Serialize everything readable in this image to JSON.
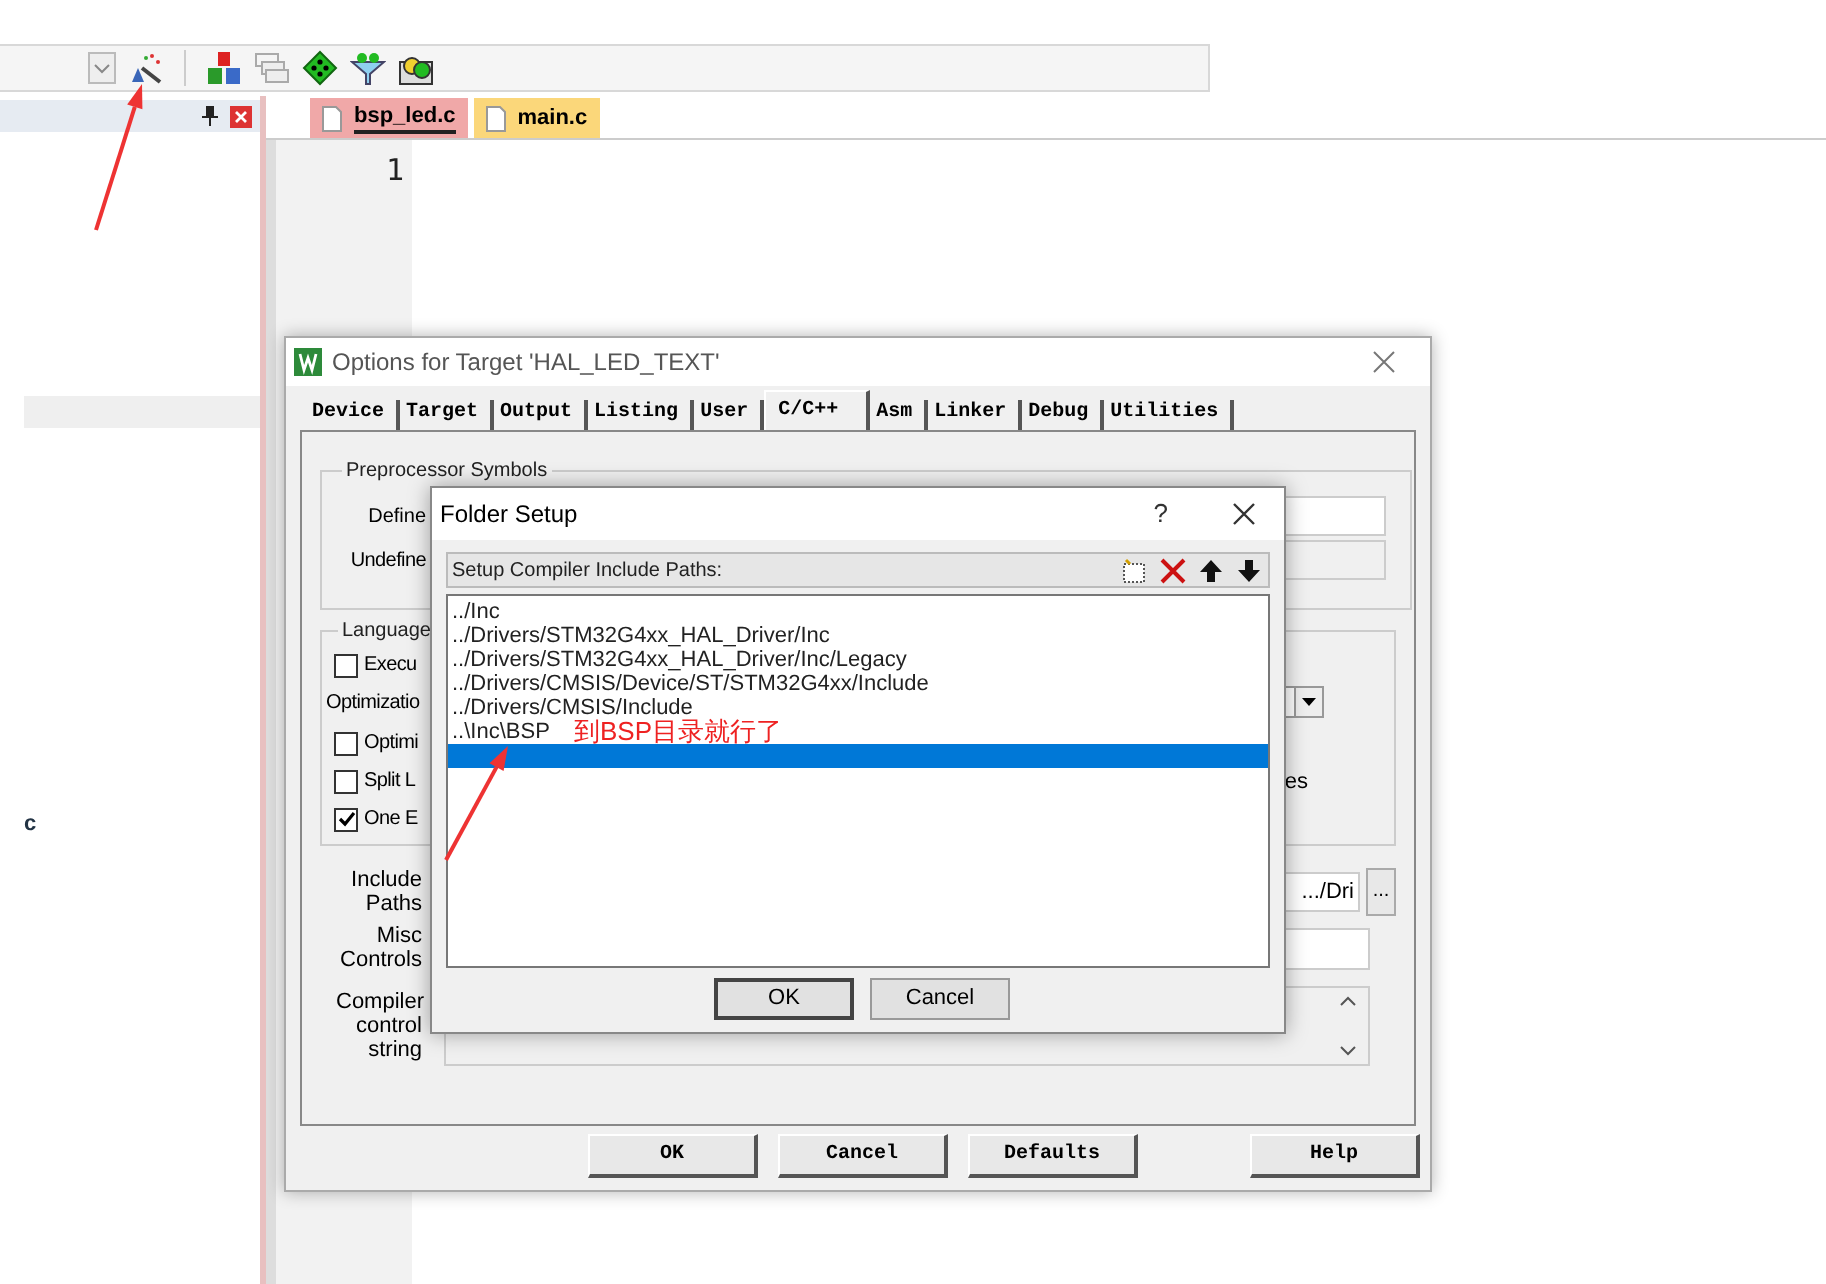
{
  "left_panel": {
    "items": [
      {
        "text": "c"
      }
    ]
  },
  "editor": {
    "tabs": [
      {
        "label": "bsp_led.c",
        "selected": true
      },
      {
        "label": "main.c",
        "selected": false
      }
    ],
    "line_numbers": [
      "1"
    ]
  },
  "options_dialog": {
    "title": "Options for Target 'HAL_LED_TEXT'",
    "tabs": [
      {
        "label": "Device",
        "selected": false
      },
      {
        "label": "Target",
        "selected": false
      },
      {
        "label": "Output",
        "selected": false
      },
      {
        "label": "Listing",
        "selected": false
      },
      {
        "label": "User",
        "selected": false
      },
      {
        "label": "C/C++",
        "selected": true
      },
      {
        "label": "Asm",
        "selected": false
      },
      {
        "label": "Linker",
        "selected": false
      },
      {
        "label": "Debug",
        "selected": false
      },
      {
        "label": "Utilities",
        "selected": false
      }
    ],
    "preprocessor": {
      "title": "Preprocessor Symbols",
      "define_label": "Define",
      "undefine_label": "Undefine"
    },
    "language": {
      "title": "Language",
      "items": [
        {
          "kind": "checkbox",
          "label": "Execu",
          "checked": false
        },
        {
          "kind": "label",
          "label": "Optimizatio"
        },
        {
          "kind": "checkbox",
          "label": "Optimi",
          "checked": false
        },
        {
          "kind": "checkbox",
          "label": "Split L",
          "checked": false
        },
        {
          "kind": "checkbox",
          "label": "One E",
          "checked": true
        }
      ],
      "right_label": "es"
    },
    "include_paths": {
      "label": "Include Paths",
      "value": ".../Dri",
      "browse": "..."
    },
    "misc_controls": {
      "label": "Misc Controls"
    },
    "compiler_string": {
      "label": "Compiler control string"
    },
    "buttons": [
      "OK",
      "Cancel",
      "Defaults",
      "Help"
    ]
  },
  "folder_setup": {
    "title": "Folder Setup",
    "help": "?",
    "header": "Setup Compiler Include Paths:",
    "paths": [
      {
        "text": "../Inc",
        "selected": false
      },
      {
        "text": "../Drivers/STM32G4xx_HAL_Driver/Inc",
        "selected": false
      },
      {
        "text": "../Drivers/STM32G4xx_HAL_Driver/Inc/Legacy",
        "selected": false
      },
      {
        "text": "../Drivers/CMSIS/Device/ST/STM32G4xx/Include",
        "selected": false
      },
      {
        "text": "../Drivers/CMSIS/Include",
        "selected": false
      },
      {
        "text": "..\\Inc\\BSP",
        "selected": false
      }
    ],
    "new_row": {
      "selected": true
    },
    "buttons": [
      "OK",
      "Cancel"
    ]
  },
  "annotation": {
    "text": "到BSP目录就行了"
  }
}
